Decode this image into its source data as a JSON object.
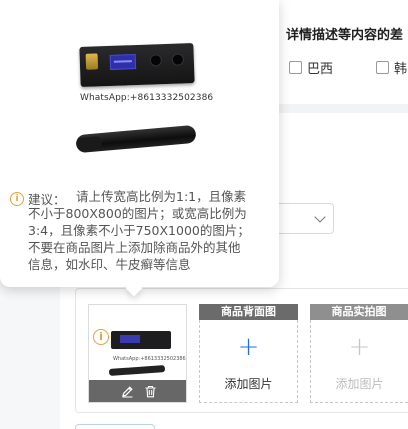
{
  "header": {
    "title": "详情描述等内容的差",
    "options": [
      {
        "label": "巴西",
        "checked": false
      },
      {
        "label": "韩",
        "checked": false
      }
    ]
  },
  "tooltip": {
    "watermark": "WhatsApp:+8613332502386",
    "tip_label": "建议：",
    "tip_lines": [
      "请上传宽高比例为1:1，且像素",
      "不小于800X800的图片；或宽高比例为",
      "3:4，且像素不小于750X1000的图片；",
      "不要在商品图片上添加除商品外的其他",
      "信息，如水印、牛皮癣等信息"
    ]
  },
  "thumbnail": {
    "watermark": "WhatsApp:+8613332502386",
    "warning_symbol": "i",
    "actions": [
      "edit-icon",
      "delete-icon"
    ]
  },
  "slots": [
    {
      "title": "商品背面图",
      "plus": "+",
      "add_label": "添加图片",
      "enabled": true
    },
    {
      "title": "商品实拍图",
      "plus": "+",
      "add_label": "添加图片",
      "enabled": false
    }
  ],
  "colors": {
    "warning": "#e6a23c",
    "primary": "#1f6fd9",
    "slot_header": "#6b6b6b"
  }
}
